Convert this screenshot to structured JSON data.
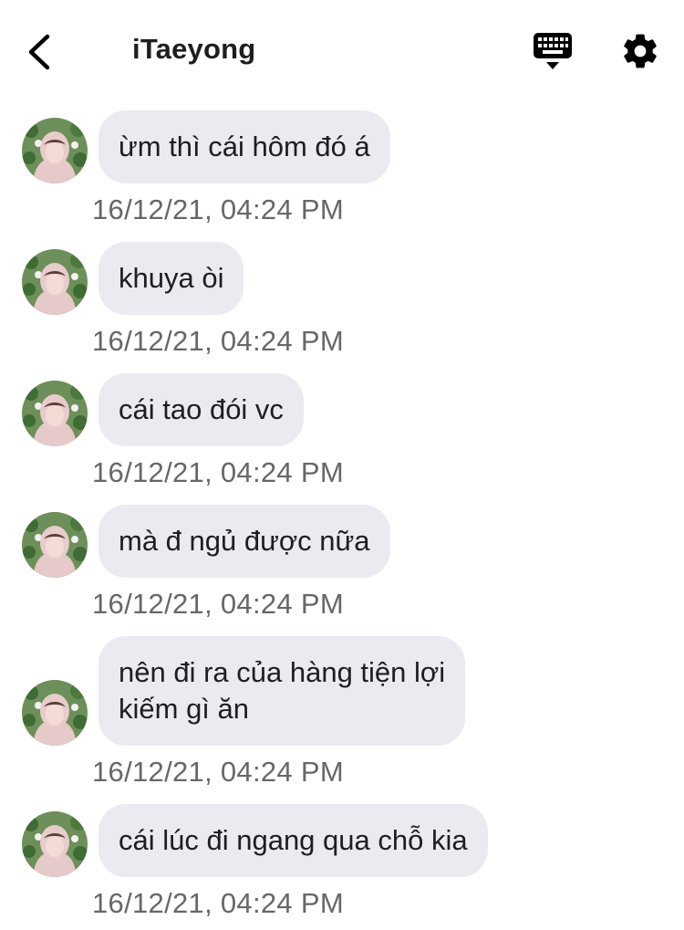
{
  "header": {
    "title": "iTaeyong",
    "back_icon": "chevron-left-icon",
    "keyboard_icon": "keyboard-icon",
    "settings_icon": "gear-icon"
  },
  "colors": {
    "bubble": "#e9ebf0",
    "timestamp": "#65676b",
    "text": "#1c1e21"
  },
  "messages": [
    {
      "text": "ừm thì cái hôm đó á",
      "time": "16/12/21, 04:24 PM"
    },
    {
      "text": "khuya òi",
      "time": "16/12/21, 04:24 PM"
    },
    {
      "text": "cái tao đói vc",
      "time": "16/12/21, 04:24 PM"
    },
    {
      "text": "mà đ ngủ được nữa",
      "time": "16/12/21, 04:24 PM"
    },
    {
      "text": "nên đi ra của hàng tiện lợi\nkiếm gì ăn",
      "time": "16/12/21, 04:24 PM"
    },
    {
      "text": "cái lúc đi ngang qua chỗ kia",
      "time": "16/12/21, 04:24 PM"
    }
  ]
}
